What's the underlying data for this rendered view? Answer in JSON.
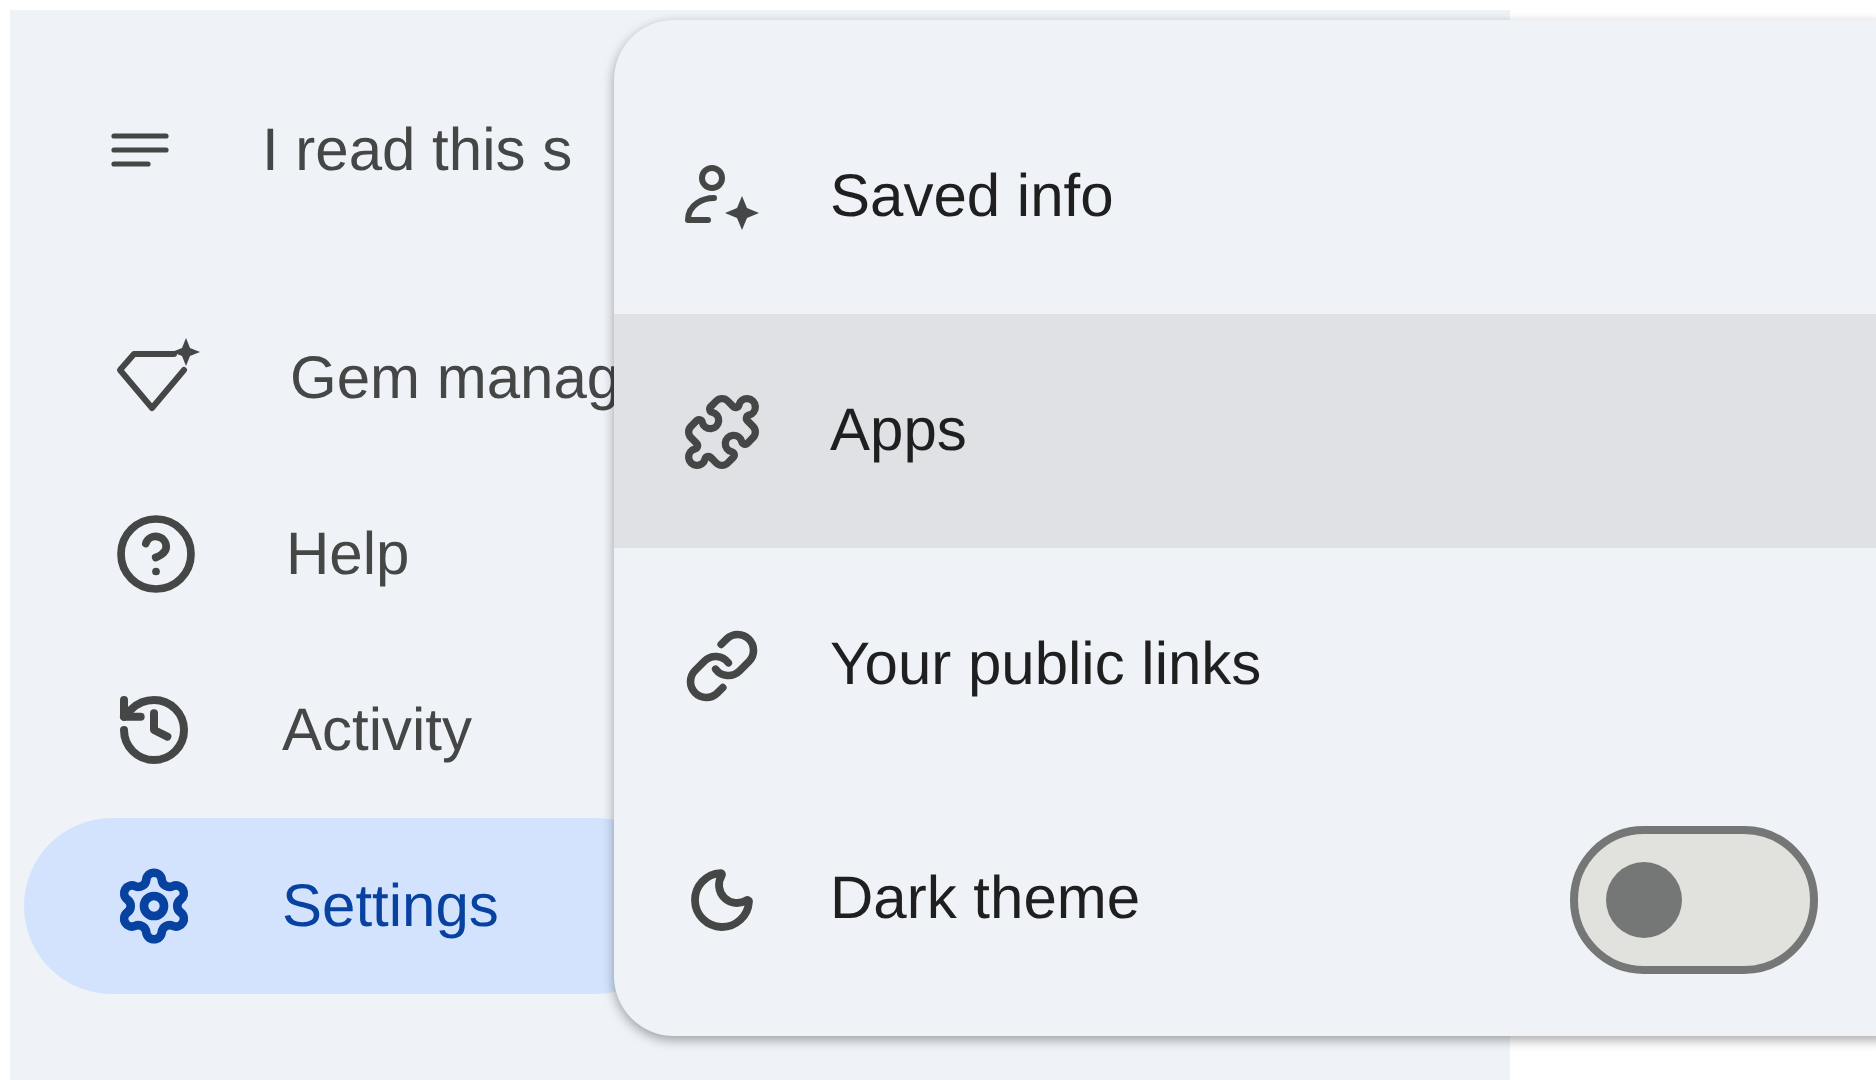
{
  "sidebar": {
    "title": "I read this s",
    "items": [
      {
        "label": "Gem manag",
        "selected": false
      },
      {
        "label": "Help",
        "selected": false
      },
      {
        "label": "Activity",
        "selected": false
      },
      {
        "label": "Settings",
        "selected": true
      }
    ]
  },
  "menu": {
    "items": [
      {
        "kind": "link",
        "label": "Saved info",
        "highlighted": false
      },
      {
        "kind": "link",
        "label": "Apps",
        "highlighted": true
      },
      {
        "kind": "link",
        "label": "Your public links",
        "highlighted": false
      },
      {
        "kind": "toggle",
        "label": "Dark theme",
        "highlighted": false,
        "on": false
      }
    ]
  }
}
